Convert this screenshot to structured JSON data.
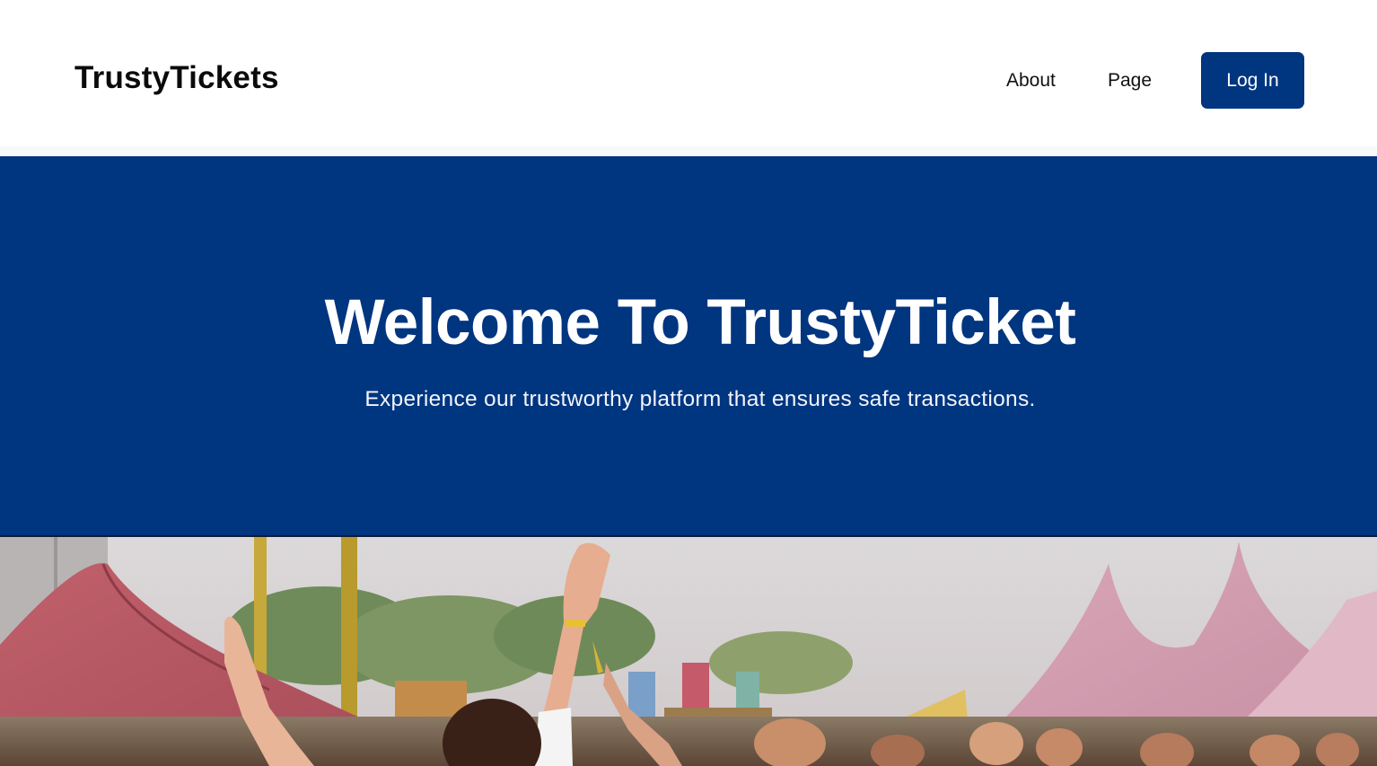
{
  "header": {
    "brand": "TrustyTickets",
    "nav": [
      {
        "label": "About"
      },
      {
        "label": "Page"
      }
    ],
    "login_label": "Log In"
  },
  "hero": {
    "title": "Welcome To TrustyTicket",
    "subtitle": "Experience our trustworthy platform that ensures safe transactions."
  },
  "image": {
    "subject": "festival crowd with raised hands and pink tents"
  },
  "colors": {
    "brand_blue": "#003580",
    "background": "#ffffff",
    "text": "#111111"
  }
}
